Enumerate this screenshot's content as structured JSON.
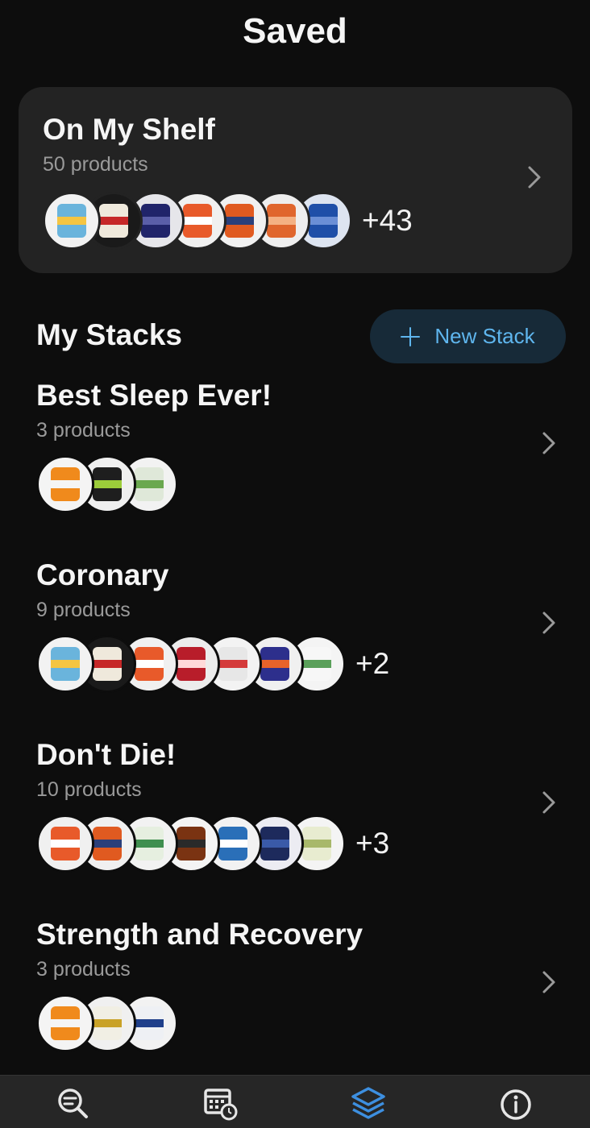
{
  "header": {
    "title": "Saved"
  },
  "shelf": {
    "title": "On My Shelf",
    "count_label": "50 products",
    "more_label": "+43",
    "products": [
      {
        "bg": "#f2f2f2",
        "label": "#6ab4dc",
        "band": "#f5c542"
      },
      {
        "bg": "#1a1a1a",
        "label": "#efe9dc",
        "band": "#c62828"
      },
      {
        "bg": "#e6e6ea",
        "label": "#20246a",
        "band": "#5a5ea8"
      },
      {
        "bg": "#f0f0f0",
        "label": "#e85a2a",
        "band": "#ffffff"
      },
      {
        "bg": "#f0f0f0",
        "label": "#e05a20",
        "band": "#2a3f7a"
      },
      {
        "bg": "#eeeeee",
        "label": "#e0662d",
        "band": "#f4b183"
      },
      {
        "bg": "#dde4f0",
        "label": "#1f4fa8",
        "band": "#6b8fd6"
      }
    ]
  },
  "stacks_section": {
    "title": "My Stacks",
    "new_stack_label": "New Stack"
  },
  "stacks": [
    {
      "name": "Best Sleep Ever!",
      "count_label": "3 products",
      "more_label": "",
      "products": [
        {
          "bg": "#f4f4f4",
          "label": "#f08a1c",
          "band": "#f5f5f5"
        },
        {
          "bg": "#efefef",
          "label": "#1e1e1e",
          "band": "#9ccc3a"
        },
        {
          "bg": "#f2f2f2",
          "label": "#dfe8d9",
          "band": "#6aa84f"
        }
      ]
    },
    {
      "name": "Coronary",
      "count_label": "9 products",
      "more_label": "+2",
      "products": [
        {
          "bg": "#f2f2f2",
          "label": "#6ab4dc",
          "band": "#f5c542"
        },
        {
          "bg": "#1a1a1a",
          "label": "#efe9dc",
          "band": "#c62828"
        },
        {
          "bg": "#f0f0f0",
          "label": "#e85a2a",
          "band": "#ffffff"
        },
        {
          "bg": "#ececec",
          "label": "#b81d2a",
          "band": "#ffd9d9"
        },
        {
          "bg": "#f3f3f3",
          "label": "#e7e7e7",
          "band": "#d43a3a"
        },
        {
          "bg": "#f0f0f0",
          "label": "#2d2f8c",
          "band": "#e8632a"
        },
        {
          "bg": "#f4f4f4",
          "label": "#f7f7f7",
          "band": "#5aa05a"
        }
      ]
    },
    {
      "name": "Don't Die!",
      "count_label": "10 products",
      "more_label": "+3",
      "products": [
        {
          "bg": "#f0f0f0",
          "label": "#e85a2a",
          "band": "#ffffff"
        },
        {
          "bg": "#f0f0f0",
          "label": "#e05a20",
          "band": "#2a3f7a"
        },
        {
          "bg": "#f2f2f2",
          "label": "#e6efe0",
          "band": "#3f8f4f"
        },
        {
          "bg": "#f4f4f4",
          "label": "#7a3312",
          "band": "#2a2a2a"
        },
        {
          "bg": "#f2f2f2",
          "label": "#2a6fb8",
          "band": "#ffffff"
        },
        {
          "bg": "#ececf2",
          "label": "#1d2a5c",
          "band": "#3a5aa8"
        },
        {
          "bg": "#f4f4f4",
          "label": "#e8ecd0",
          "band": "#a8b86a"
        }
      ]
    },
    {
      "name": "Strength and Recovery",
      "count_label": "3 products",
      "more_label": "",
      "products": [
        {
          "bg": "#f4f4f4",
          "label": "#f08a1c",
          "band": "#f5f5f5"
        },
        {
          "bg": "#f0f0f0",
          "label": "#f1efe4",
          "band": "#c9a227"
        },
        {
          "bg": "#f2f2f2",
          "label": "#eef0f4",
          "band": "#1f3f8a"
        }
      ]
    }
  ],
  "nav": {
    "accent": "#3d8fe0",
    "inactive": "#e6e6e6",
    "items": [
      {
        "icon": "search-icon"
      },
      {
        "icon": "calendar-clock-icon"
      },
      {
        "icon": "layers-icon",
        "active": true
      },
      {
        "icon": "info-icon"
      }
    ]
  }
}
